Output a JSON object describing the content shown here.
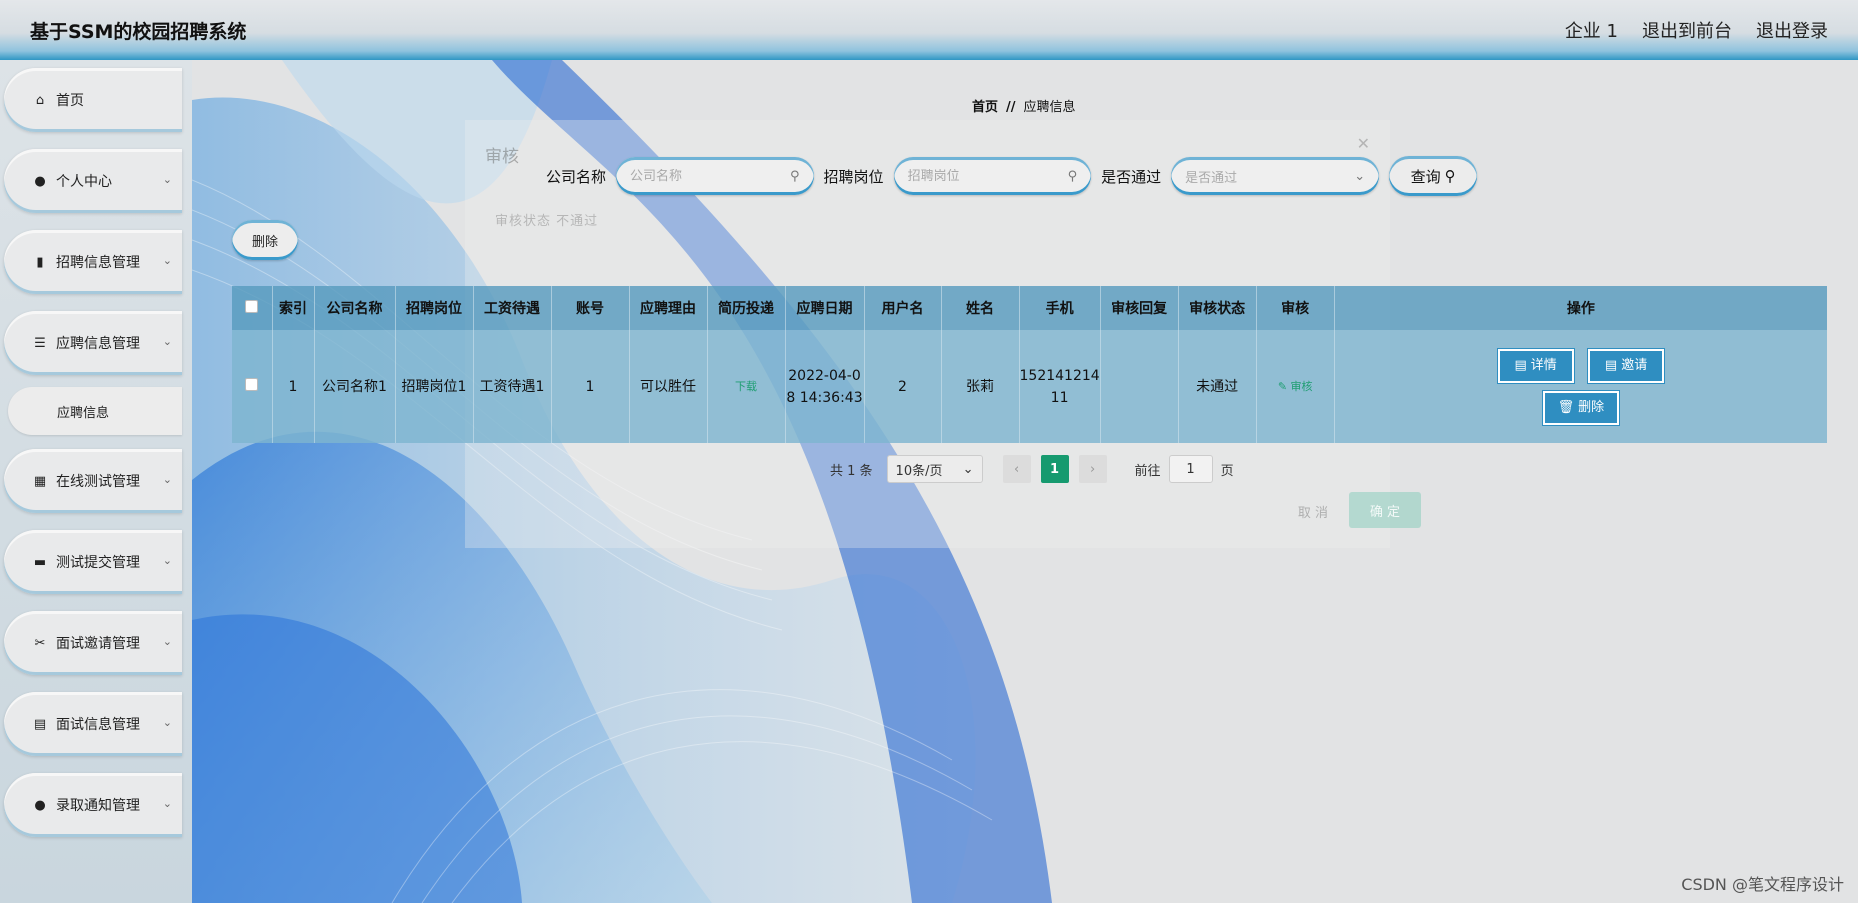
{
  "header": {
    "title": "基于SSM的校园招聘系统",
    "nav": [
      "企业 1",
      "退出到前台",
      "退出登录"
    ]
  },
  "sidebar": {
    "items": [
      {
        "label": "首页",
        "icon": "home-icon",
        "glyph": "⌂",
        "expandable": false
      },
      {
        "label": "个人中心",
        "icon": "user-icon",
        "glyph": "👤",
        "expandable": true
      },
      {
        "label": "招聘信息管理",
        "icon": "book-icon",
        "glyph": "▮",
        "expandable": true
      },
      {
        "label": "应聘信息管理",
        "icon": "list-icon",
        "glyph": "☰",
        "expandable": true,
        "open": true
      },
      {
        "label": "在线测试管理",
        "icon": "grid-icon",
        "glyph": "▦",
        "expandable": true
      },
      {
        "label": "测试提交管理",
        "icon": "monitor-icon",
        "glyph": "▬",
        "expandable": true
      },
      {
        "label": "面试邀请管理",
        "icon": "ticket-icon",
        "glyph": "✂",
        "expandable": true
      },
      {
        "label": "面试信息管理",
        "icon": "clipboard-icon",
        "glyph": "▤",
        "expandable": true
      },
      {
        "label": "录取通知管理",
        "icon": "pin-icon",
        "glyph": "●",
        "expandable": true
      }
    ],
    "subitem": "应聘信息"
  },
  "breadcrumb": {
    "home": "首页",
    "separator": "//",
    "current": "应聘信息"
  },
  "search": {
    "company_label": "公司名称",
    "company_placeholder": "公司名称",
    "position_label": "招聘岗位",
    "position_placeholder": "招聘岗位",
    "passed_label": "是否通过",
    "passed_placeholder": "是否通过",
    "query_button": "查询"
  },
  "delete_button": "删除",
  "table": {
    "headers": [
      "索引",
      "公司名称",
      "招聘岗位",
      "工资待遇",
      "账号",
      "应聘理由",
      "简历投递",
      "应聘日期",
      "用户名",
      "姓名",
      "手机",
      "审核回复",
      "审核状态",
      "审核",
      "操作"
    ],
    "rows": [
      {
        "index": "1",
        "company": "公司名称1",
        "position": "招聘岗位1",
        "salary": "工资待遇1",
        "account": "1",
        "reason": "可以胜任",
        "resume": "下载",
        "date_line1": "2022-04-0",
        "date_line2": "8 14:36:43",
        "username": "2",
        "name": "张莉",
        "phone_line1": "152141214",
        "phone_line2": "11",
        "reply": "",
        "status": "未通过",
        "audit": "审核",
        "ops": {
          "detail": "详情",
          "invite": "邀请",
          "delete": "删除"
        }
      }
    ]
  },
  "pagination": {
    "total": "共 1 条",
    "page_size": "10条/页",
    "current_page": "1",
    "goto_label": "前往",
    "goto_value": "1",
    "page_unit": "页"
  },
  "dialog_ghost": {
    "title": "审核",
    "options": "审核状态   不通过",
    "cancel": "取 消",
    "ok": "确 定"
  },
  "watermark": "CSDN @笔文程序设计",
  "colors": {
    "accent": "#2f8ec1",
    "pager_active": "#169a6f",
    "link_green": "#1f9e72"
  }
}
